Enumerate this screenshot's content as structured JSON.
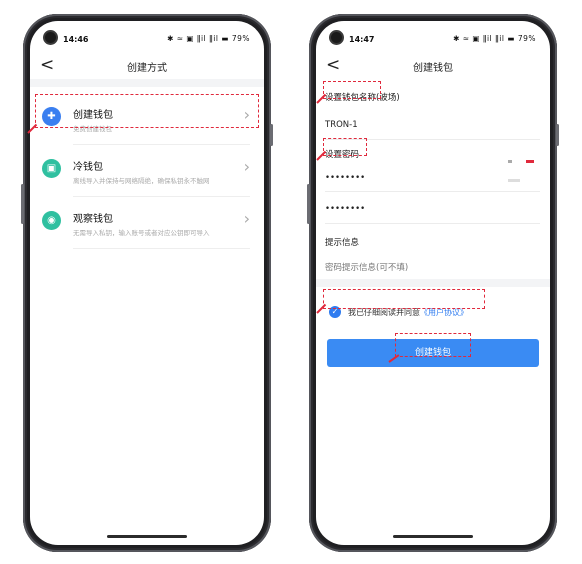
{
  "left": {
    "status": {
      "time": "14:46",
      "icons": "✱ ≈ ▣ ǁil ǁil ▬ 79%"
    },
    "nav": {
      "back": "<",
      "title": "创建方式"
    },
    "options": [
      {
        "icon": "wallet-add",
        "title": "创建钱包",
        "sub": "免费创建钱包",
        "color": "#3a7ff0"
      },
      {
        "icon": "cold-wallet",
        "title": "冷钱包",
        "sub": "离线导入并保持与网络隔绝，确保私钥永不触网",
        "color": "#2fc0a0"
      },
      {
        "icon": "eye",
        "title": "观察钱包",
        "sub": "无需导入私钥，输入账号或者对应公钥即可导入",
        "color": "#2fc0a0"
      }
    ]
  },
  "right": {
    "status": {
      "time": "14:47",
      "icons": "✱ ≈ ▣ ǁil ǁil ▬ 79%"
    },
    "nav": {
      "back": "<",
      "title": "创建钱包"
    },
    "form": {
      "name_label": "设置钱包名称(波场)",
      "name_value": "TRON-1",
      "password_label": "设置密码",
      "password_value": "••••••••",
      "confirm_value": "••••••••",
      "hint_label": "提示信息",
      "hint_placeholder": "密码提示信息(可不填)",
      "agree_text": "我已仔细阅读并同意",
      "agree_link": "《用户协议》",
      "submit": "创建钱包"
    },
    "colors": {
      "accent": "#3a8bf3",
      "annotation": "#e0293c"
    }
  }
}
